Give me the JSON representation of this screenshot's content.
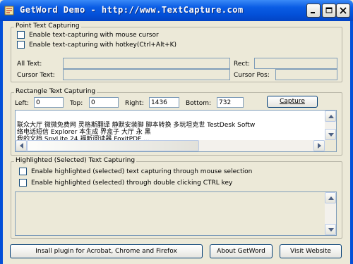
{
  "window": {
    "title": "GetWord Demo - http://www.TextCapture.com",
    "controls": [
      "minimize",
      "maximize",
      "close"
    ]
  },
  "point_group": {
    "title": "Point Text Capturing",
    "check_mouse": "Enable text-capturing with mouse cursor",
    "check_hotkey": "Enable text-capturing with hotkey(Ctrl+Alt+K)",
    "all_text_label": "All Text:",
    "rect_label": "Rect:",
    "cursor_text_label": "Cursor Text:",
    "cursor_pos_label": "Cursor Pos:"
  },
  "rect_group": {
    "title": "Rectangle Text Capturing",
    "left_label": "Left:",
    "left_value": "0",
    "top_label": "Top:",
    "top_value": "0",
    "right_label": "Right:",
    "right_value": "1436",
    "bottom_label": "Bottom:",
    "bottom_value": "732",
    "capture_button": "Capture",
    "captured_lines": [
      "联众大厅 微微免费网  灵格斯翻译  静默安装脚  脚本转换  多玩坦克世   TestDesk Softw",
      "络电话短信   Explorer 本生成 界盒子 大厅 永 黑",
      "我的文档   SpyLite 24 福昕阅读器   FoxitPDF ..."
    ]
  },
  "highlight_group": {
    "title": "Highlighted (Selected) Text Capturing",
    "check_mouse": "Enable highlighted (selected) text capturing through mouse selection",
    "check_ctrl": "Enable highlighted (selected) through double clicking CTRL key"
  },
  "footer": {
    "install_button": "Insall plugin for Acrobat, Chrome and Firefox",
    "about_button": "About GetWord",
    "visit_button": "Visit Website"
  }
}
